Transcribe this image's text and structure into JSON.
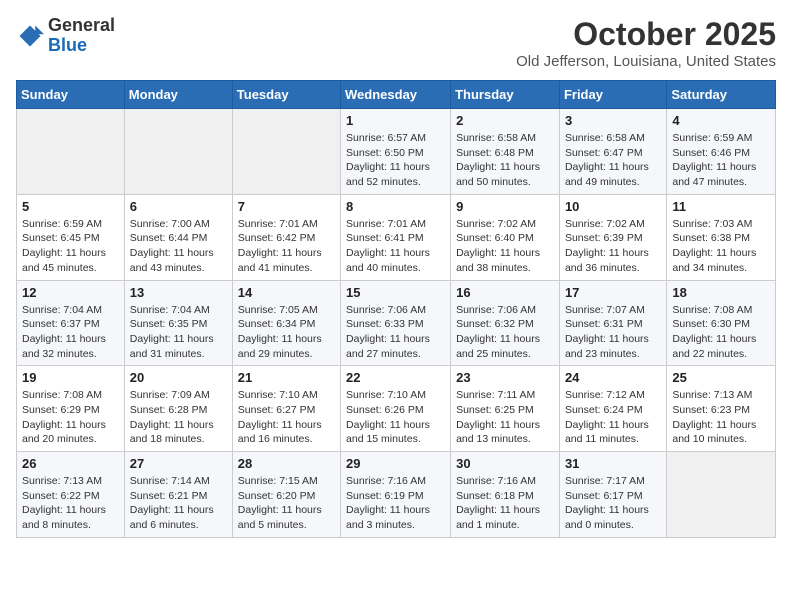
{
  "header": {
    "logo_general": "General",
    "logo_blue": "Blue",
    "month": "October 2025",
    "location": "Old Jefferson, Louisiana, United States"
  },
  "weekdays": [
    "Sunday",
    "Monday",
    "Tuesday",
    "Wednesday",
    "Thursday",
    "Friday",
    "Saturday"
  ],
  "weeks": [
    [
      {
        "day": "",
        "info": ""
      },
      {
        "day": "",
        "info": ""
      },
      {
        "day": "",
        "info": ""
      },
      {
        "day": "1",
        "info": "Sunrise: 6:57 AM\nSunset: 6:50 PM\nDaylight: 11 hours and 52 minutes."
      },
      {
        "day": "2",
        "info": "Sunrise: 6:58 AM\nSunset: 6:48 PM\nDaylight: 11 hours and 50 minutes."
      },
      {
        "day": "3",
        "info": "Sunrise: 6:58 AM\nSunset: 6:47 PM\nDaylight: 11 hours and 49 minutes."
      },
      {
        "day": "4",
        "info": "Sunrise: 6:59 AM\nSunset: 6:46 PM\nDaylight: 11 hours and 47 minutes."
      }
    ],
    [
      {
        "day": "5",
        "info": "Sunrise: 6:59 AM\nSunset: 6:45 PM\nDaylight: 11 hours and 45 minutes."
      },
      {
        "day": "6",
        "info": "Sunrise: 7:00 AM\nSunset: 6:44 PM\nDaylight: 11 hours and 43 minutes."
      },
      {
        "day": "7",
        "info": "Sunrise: 7:01 AM\nSunset: 6:42 PM\nDaylight: 11 hours and 41 minutes."
      },
      {
        "day": "8",
        "info": "Sunrise: 7:01 AM\nSunset: 6:41 PM\nDaylight: 11 hours and 40 minutes."
      },
      {
        "day": "9",
        "info": "Sunrise: 7:02 AM\nSunset: 6:40 PM\nDaylight: 11 hours and 38 minutes."
      },
      {
        "day": "10",
        "info": "Sunrise: 7:02 AM\nSunset: 6:39 PM\nDaylight: 11 hours and 36 minutes."
      },
      {
        "day": "11",
        "info": "Sunrise: 7:03 AM\nSunset: 6:38 PM\nDaylight: 11 hours and 34 minutes."
      }
    ],
    [
      {
        "day": "12",
        "info": "Sunrise: 7:04 AM\nSunset: 6:37 PM\nDaylight: 11 hours and 32 minutes."
      },
      {
        "day": "13",
        "info": "Sunrise: 7:04 AM\nSunset: 6:35 PM\nDaylight: 11 hours and 31 minutes."
      },
      {
        "day": "14",
        "info": "Sunrise: 7:05 AM\nSunset: 6:34 PM\nDaylight: 11 hours and 29 minutes."
      },
      {
        "day": "15",
        "info": "Sunrise: 7:06 AM\nSunset: 6:33 PM\nDaylight: 11 hours and 27 minutes."
      },
      {
        "day": "16",
        "info": "Sunrise: 7:06 AM\nSunset: 6:32 PM\nDaylight: 11 hours and 25 minutes."
      },
      {
        "day": "17",
        "info": "Sunrise: 7:07 AM\nSunset: 6:31 PM\nDaylight: 11 hours and 23 minutes."
      },
      {
        "day": "18",
        "info": "Sunrise: 7:08 AM\nSunset: 6:30 PM\nDaylight: 11 hours and 22 minutes."
      }
    ],
    [
      {
        "day": "19",
        "info": "Sunrise: 7:08 AM\nSunset: 6:29 PM\nDaylight: 11 hours and 20 minutes."
      },
      {
        "day": "20",
        "info": "Sunrise: 7:09 AM\nSunset: 6:28 PM\nDaylight: 11 hours and 18 minutes."
      },
      {
        "day": "21",
        "info": "Sunrise: 7:10 AM\nSunset: 6:27 PM\nDaylight: 11 hours and 16 minutes."
      },
      {
        "day": "22",
        "info": "Sunrise: 7:10 AM\nSunset: 6:26 PM\nDaylight: 11 hours and 15 minutes."
      },
      {
        "day": "23",
        "info": "Sunrise: 7:11 AM\nSunset: 6:25 PM\nDaylight: 11 hours and 13 minutes."
      },
      {
        "day": "24",
        "info": "Sunrise: 7:12 AM\nSunset: 6:24 PM\nDaylight: 11 hours and 11 minutes."
      },
      {
        "day": "25",
        "info": "Sunrise: 7:13 AM\nSunset: 6:23 PM\nDaylight: 11 hours and 10 minutes."
      }
    ],
    [
      {
        "day": "26",
        "info": "Sunrise: 7:13 AM\nSunset: 6:22 PM\nDaylight: 11 hours and 8 minutes."
      },
      {
        "day": "27",
        "info": "Sunrise: 7:14 AM\nSunset: 6:21 PM\nDaylight: 11 hours and 6 minutes."
      },
      {
        "day": "28",
        "info": "Sunrise: 7:15 AM\nSunset: 6:20 PM\nDaylight: 11 hours and 5 minutes."
      },
      {
        "day": "29",
        "info": "Sunrise: 7:16 AM\nSunset: 6:19 PM\nDaylight: 11 hours and 3 minutes."
      },
      {
        "day": "30",
        "info": "Sunrise: 7:16 AM\nSunset: 6:18 PM\nDaylight: 11 hours and 1 minute."
      },
      {
        "day": "31",
        "info": "Sunrise: 7:17 AM\nSunset: 6:17 PM\nDaylight: 11 hours and 0 minutes."
      },
      {
        "day": "",
        "info": ""
      }
    ]
  ],
  "colors": {
    "header_bg": "#2a6db5",
    "odd_row": "#f5f7fa",
    "even_row": "#ffffff",
    "empty_cell": "#f0f0f0"
  }
}
